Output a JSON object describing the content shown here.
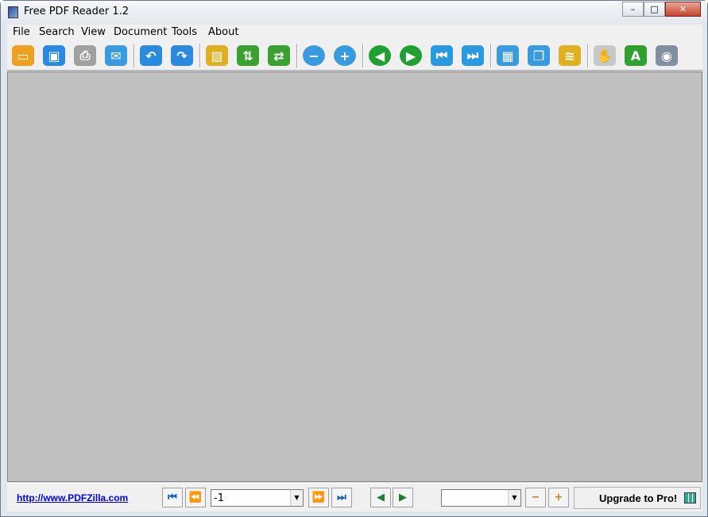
{
  "window": {
    "title": "Free PDF Reader 1.2",
    "controls": [
      "minimize",
      "maximize",
      "close"
    ]
  },
  "menu": [
    "File",
    "Search",
    "View",
    "Document",
    "Tools",
    "About"
  ],
  "toolbar": [
    {
      "icon": "open-folder-icon",
      "color": "#f0a020"
    },
    {
      "icon": "save-icon",
      "color": "#2a8ae0"
    },
    {
      "icon": "print-icon",
      "color": "#a0a0a0"
    },
    {
      "icon": "email-icon",
      "color": "#3a9ae0"
    },
    {
      "sep": true
    },
    {
      "icon": "undo-icon",
      "color": "#2a8ae0"
    },
    {
      "icon": "redo-icon",
      "color": "#2a8ae0"
    },
    {
      "sep": true
    },
    {
      "icon": "image-icon",
      "color": "#e0b020"
    },
    {
      "icon": "rotate-icon",
      "color": "#3aa030"
    },
    {
      "icon": "swap-icon",
      "color": "#3aa030"
    },
    {
      "sep": true
    },
    {
      "icon": "zoom-out-icon",
      "color": "#3a9ae0"
    },
    {
      "icon": "zoom-in-icon",
      "color": "#3a9ae0"
    },
    {
      "sep": true
    },
    {
      "icon": "previous-icon",
      "color": "#20a030"
    },
    {
      "icon": "next-icon",
      "color": "#20a030"
    },
    {
      "icon": "first-page-icon",
      "color": "#2a9ae0"
    },
    {
      "icon": "last-page-icon",
      "color": "#2a9ae0"
    },
    {
      "sep": true
    },
    {
      "icon": "single-page-icon",
      "color": "#3a9ae0"
    },
    {
      "icon": "multi-page-icon",
      "color": "#3a9ae0"
    },
    {
      "icon": "scroll-icon",
      "color": "#e0b020"
    },
    {
      "sep": true
    },
    {
      "icon": "hand-icon",
      "color": "#c8c8c8"
    },
    {
      "icon": "text-select-icon",
      "color": "#30a030"
    },
    {
      "icon": "snapshot-icon",
      "color": "#8090a0"
    }
  ],
  "status": {
    "link": "http://www.PDFZilla.com",
    "page_value": "-1",
    "zoom_value": "",
    "upgrade": "Upgrade to Pro!"
  }
}
